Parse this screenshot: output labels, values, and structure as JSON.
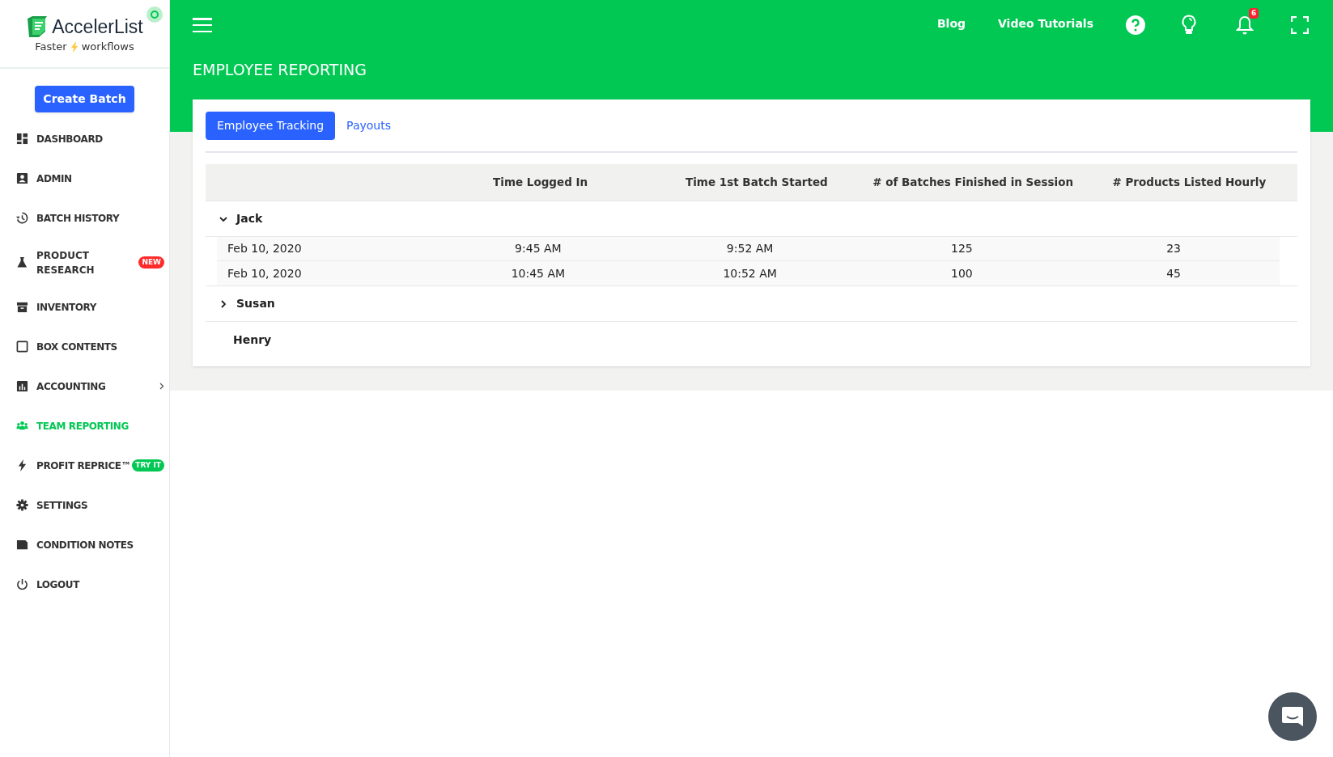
{
  "sidebar": {
    "logo": {
      "name": "AccelerList",
      "tagline_left": "Faster",
      "tagline_right": "workflows"
    },
    "create_button": "Create Batch",
    "items": [
      {
        "label": "DASHBOARD",
        "selected": false,
        "submenu": false
      },
      {
        "label": "ADMIN",
        "selected": false,
        "submenu": false
      },
      {
        "label": "BATCH HISTORY",
        "selected": false,
        "submenu": false
      },
      {
        "label": "PRODUCT RESEARCH",
        "selected": false,
        "submenu": false,
        "badge": {
          "text": "NEW",
          "color": "#ff2b2b"
        }
      },
      {
        "label": "INVENTORY",
        "selected": false,
        "submenu": false
      },
      {
        "label": "BOX CONTENTS",
        "selected": false,
        "submenu": false
      },
      {
        "label": "ACCOUNTING",
        "selected": false,
        "submenu": true
      },
      {
        "label": "TEAM REPORTING",
        "selected": true,
        "submenu": false
      },
      {
        "label": "PROFIT REPRICE™",
        "selected": false,
        "submenu": false,
        "badge": {
          "text": "TRY IT",
          "color": "#00c853"
        }
      },
      {
        "label": "SETTINGS",
        "selected": false,
        "submenu": false
      },
      {
        "label": "CONDITION NOTES",
        "selected": false,
        "submenu": false
      },
      {
        "label": "LOGOUT",
        "selected": false,
        "submenu": false
      }
    ]
  },
  "topbar": {
    "links": [
      "Blog",
      "Video Tutorials"
    ],
    "notification_count": "6"
  },
  "page_title": "EMPLOYEE REPORTING",
  "tabs": [
    {
      "label": "Employee Tracking",
      "selected": true
    },
    {
      "label": "Payouts",
      "selected": false
    }
  ],
  "table": {
    "columns": [
      "Time Logged In",
      "Time 1st Batch Started",
      "# of Batches Finished in Session",
      "# Products Listed Hourly"
    ],
    "groups": [
      {
        "name": "Jack",
        "kind": "expandable",
        "expanded": true,
        "rows": [
          [
            "Feb 10, 2020",
            "9:45 AM",
            "9:52 AM",
            "125",
            "23"
          ],
          [
            "Feb 10, 2020",
            "10:45 AM",
            "10:52 AM",
            "100",
            "45"
          ]
        ]
      },
      {
        "name": "Susan",
        "kind": "expandable",
        "expanded": false
      },
      {
        "name": "Henry",
        "kind": "plain"
      }
    ]
  }
}
